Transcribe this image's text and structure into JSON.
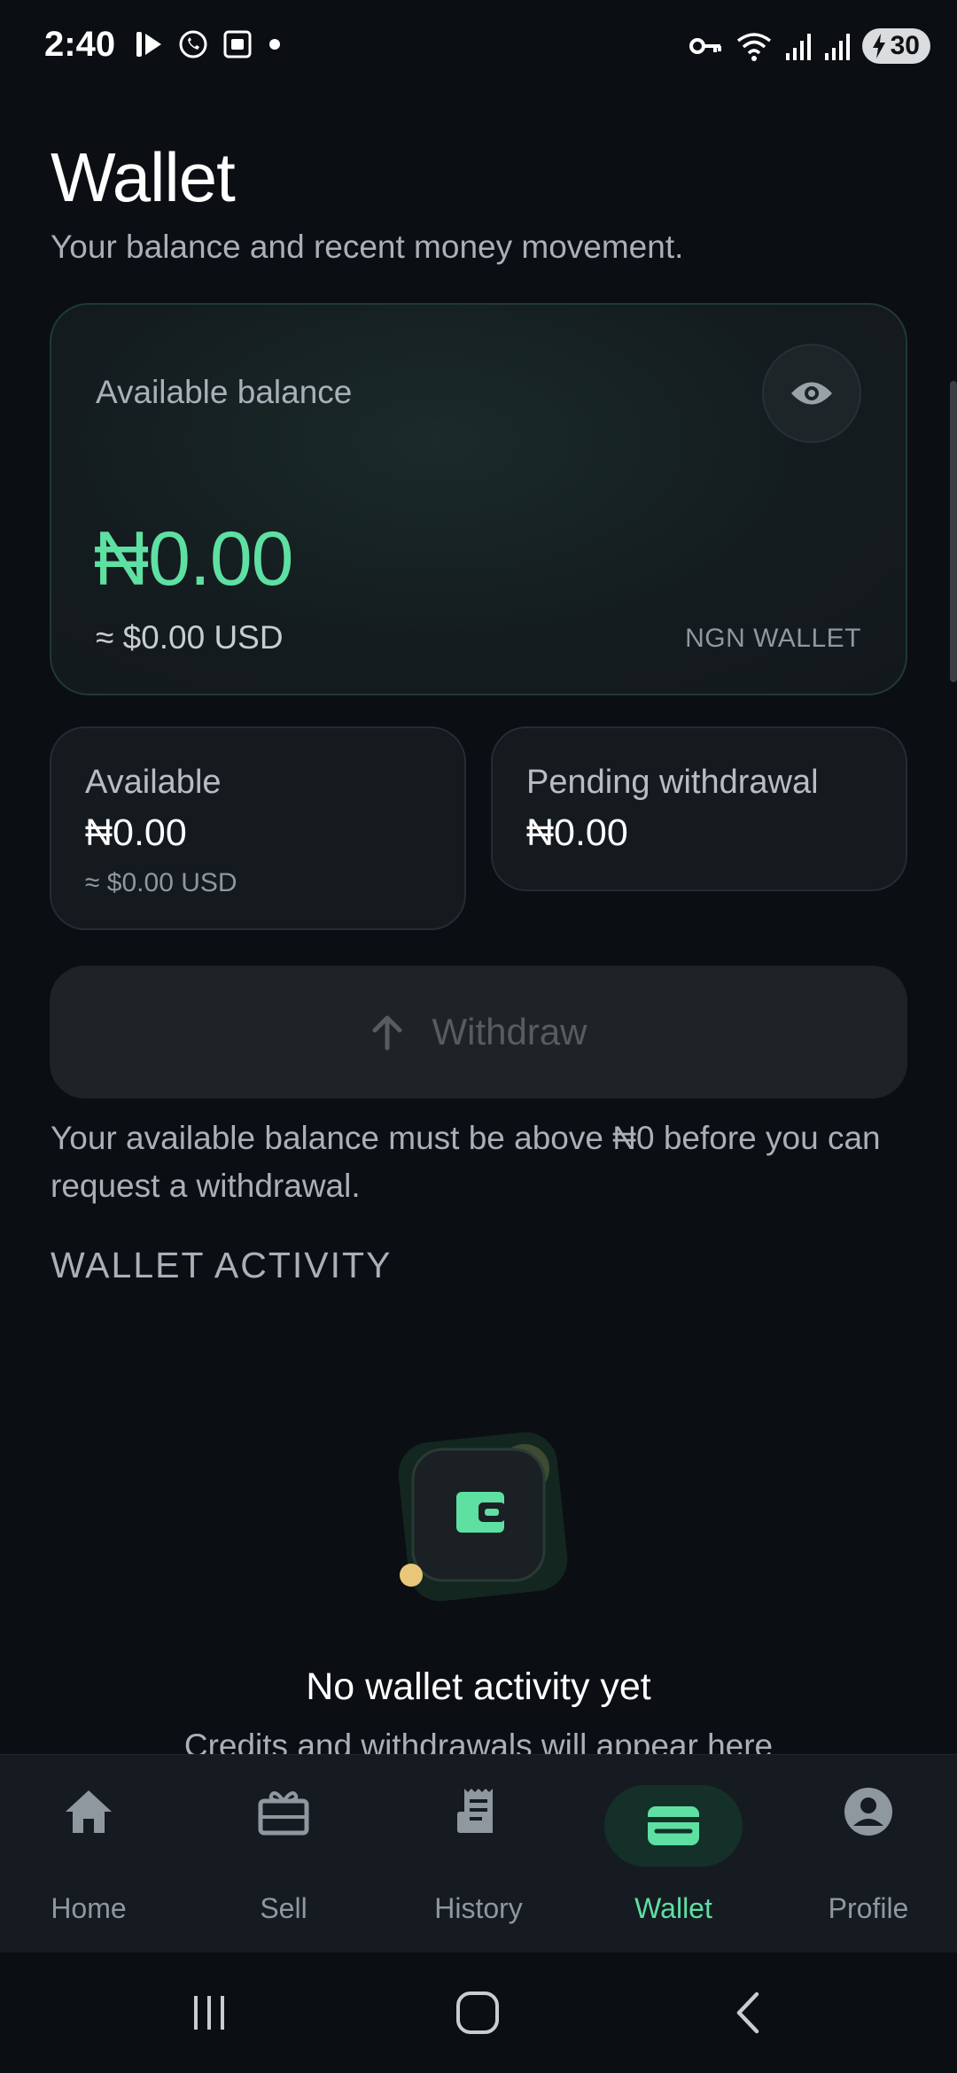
{
  "status_bar": {
    "time": "2:40",
    "battery": "30",
    "left_icons": [
      "media-icon",
      "whatsapp-icon",
      "screenshot-icon",
      "dot-icon"
    ],
    "right_icons": [
      "key-icon",
      "wifi-icon",
      "signal-icon",
      "signal-icon"
    ]
  },
  "header": {
    "title": "Wallet",
    "subtitle": "Your balance and recent money movement."
  },
  "balance_card": {
    "label": "Available balance",
    "amount": "₦0.00",
    "usd": "≈ $0.00 USD",
    "wallet_tag": "NGN WALLET",
    "toggle_icon": "eye-icon"
  },
  "stats": {
    "available": {
      "label": "Available",
      "value": "₦0.00",
      "sub": "≈ $0.00 USD"
    },
    "pending": {
      "label": "Pending withdrawal",
      "value": "₦0.00"
    }
  },
  "withdraw": {
    "label": "Withdraw",
    "icon": "arrow-up-icon",
    "note": "Your available balance must be above ₦0 before you can request a withdrawal."
  },
  "activity": {
    "heading": "WALLET ACTIVITY",
    "empty_title": "No wallet activity yet",
    "empty_subtitle": "Credits and withdrawals will appear here"
  },
  "bottom_nav": {
    "items": [
      {
        "label": "Home",
        "icon": "home-icon",
        "active": false
      },
      {
        "label": "Sell",
        "icon": "gift-card-icon",
        "active": false
      },
      {
        "label": "History",
        "icon": "receipt-icon",
        "active": false
      },
      {
        "label": "Wallet",
        "icon": "wallet-icon",
        "active": true
      },
      {
        "label": "Profile",
        "icon": "profile-icon",
        "active": false
      }
    ]
  },
  "colors": {
    "accent": "#5ee0a3",
    "background": "#0b0e12",
    "card": "#151a1f",
    "muted_text": "#a9b0b8"
  }
}
